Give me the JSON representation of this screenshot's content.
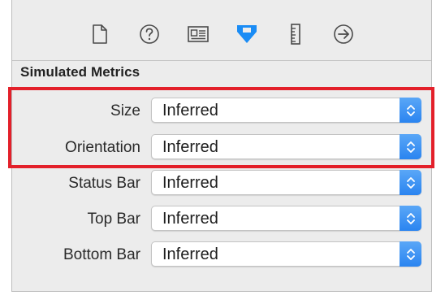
{
  "toolbar": {
    "icons": [
      {
        "name": "file-inspector-icon",
        "active": false
      },
      {
        "name": "quick-help-icon",
        "active": false
      },
      {
        "name": "identity-inspector-icon",
        "active": false
      },
      {
        "name": "attributes-inspector-icon",
        "active": true
      },
      {
        "name": "size-inspector-icon",
        "active": false
      },
      {
        "name": "connections-inspector-icon",
        "active": false
      }
    ],
    "active_color": "#1a8cf5",
    "inactive_color": "#4a4a4a"
  },
  "section": {
    "title": "Simulated Metrics"
  },
  "fields": [
    {
      "label": "Size",
      "value": "Inferred"
    },
    {
      "label": "Orientation",
      "value": "Inferred"
    },
    {
      "label": "Status Bar",
      "value": "Inferred"
    },
    {
      "label": "Top Bar",
      "value": "Inferred"
    },
    {
      "label": "Bottom Bar",
      "value": "Inferred"
    }
  ],
  "highlight": {
    "color": "#e3202a"
  }
}
